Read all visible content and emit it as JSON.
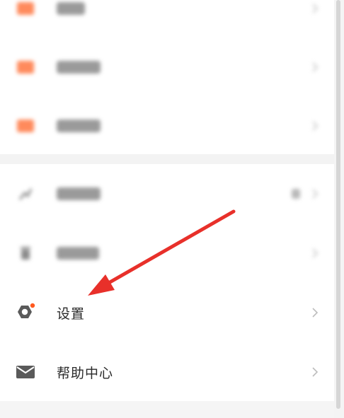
{
  "menu": {
    "settings": {
      "label": "设置",
      "icon": "settings-gear-icon"
    },
    "help": {
      "label": "帮助中心",
      "icon": "mail-icon"
    }
  },
  "blurred_items": [
    {
      "icon": "orange-block-icon"
    },
    {
      "icon": "orange-block-icon"
    },
    {
      "icon": "orange-block-icon"
    },
    {
      "icon": "chart-icon"
    },
    {
      "icon": "trash-icon"
    }
  ],
  "colors": {
    "annotation_arrow": "#e8302a",
    "blurred_icon": "#ff8a5c",
    "settings_dot": "#ff5a1f",
    "icon_gray": "#5a5a5a",
    "text": "#2a2a2a"
  }
}
